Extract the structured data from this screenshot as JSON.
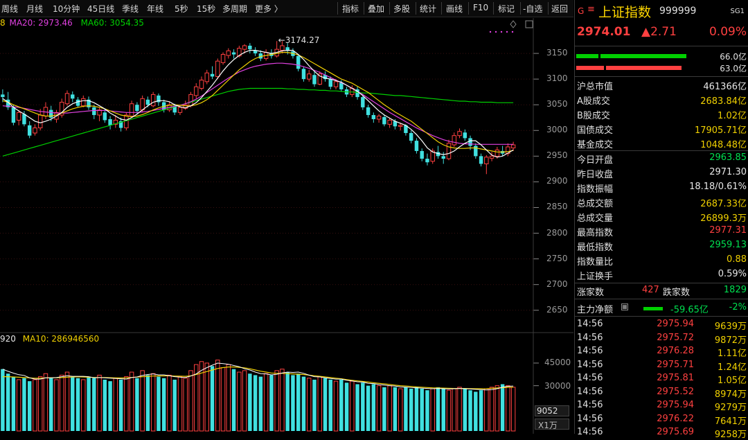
{
  "toolbar": {
    "periods": [
      "周线",
      "月线",
      "10分钟",
      "45日线",
      "季线",
      "年线",
      "5秒",
      "15秒",
      "多周期",
      "更多 〉"
    ],
    "tools": [
      "指标",
      "叠加",
      "多股",
      "统计",
      "画线",
      "F10",
      "标记",
      "-自选",
      "返回"
    ]
  },
  "chart": {
    "ma_legend": {
      "ma_prefix": "8",
      "ma20": "MA20: 2973.46",
      "ma60": "MA60: 3054.35"
    },
    "peak_label": "3174.27",
    "y_ticks": [
      "3150",
      "3100",
      "3050",
      "3000",
      "2950",
      "2900",
      "2850",
      "2800",
      "2750",
      "2700",
      "2650"
    ],
    "vol_legend": {
      "prefix": "920",
      "ma10": "MA10: 286946560"
    },
    "vol_ticks": [
      "45000",
      "30000"
    ],
    "vol_value": "9052",
    "vol_unit": "X1万",
    "colors": {
      "up": "#ff4040",
      "down": "#40e0e0",
      "ma5": "#ffffff",
      "ma10": "#f0d000",
      "ma20": "#e040e0",
      "ma60": "#00d000"
    }
  },
  "chart_data": {
    "type": "candlestick",
    "ylim": [
      2620,
      3200
    ],
    "candles": [
      [
        3070,
        3065,
        3080,
        3055
      ],
      [
        3060,
        3045,
        3075,
        3040
      ],
      [
        3045,
        3015,
        3050,
        3010
      ],
      [
        3020,
        3035,
        3040,
        3010
      ],
      [
        3032,
        3012,
        3038,
        3008
      ],
      [
        3010,
        2990,
        3018,
        2985
      ],
      [
        2995,
        3005,
        3012,
        2990
      ],
      [
        3005,
        3030,
        3042,
        3000
      ],
      [
        3028,
        3045,
        3055,
        3022
      ],
      [
        3040,
        3025,
        3048,
        3018
      ],
      [
        3022,
        3035,
        3040,
        3015
      ],
      [
        3030,
        3055,
        3062,
        3025
      ],
      [
        3052,
        3072,
        3078,
        3048
      ],
      [
        3070,
        3062,
        3076,
        3055
      ],
      [
        3060,
        3048,
        3065,
        3045
      ],
      [
        3048,
        3062,
        3068,
        3045
      ],
      [
        3060,
        3045,
        3066,
        3040
      ],
      [
        3045,
        3030,
        3050,
        3022
      ],
      [
        3030,
        3040,
        3045,
        3018
      ],
      [
        3035,
        3020,
        3042,
        3015
      ],
      [
        3022,
        3010,
        3028,
        3002
      ],
      [
        3012,
        3020,
        3030,
        3005
      ],
      [
        3018,
        3005,
        3025,
        2998
      ],
      [
        3005,
        3030,
        3035,
        3000
      ],
      [
        3028,
        3052,
        3058,
        3025
      ],
      [
        3050,
        3038,
        3055,
        3032
      ],
      [
        3040,
        3062,
        3068,
        3035
      ],
      [
        3060,
        3050,
        3066,
        3045
      ],
      [
        3048,
        3070,
        3075,
        3045
      ],
      [
        3068,
        3055,
        3072,
        3048
      ],
      [
        3055,
        3040,
        3060,
        3035
      ],
      [
        3040,
        3050,
        3056,
        3036
      ],
      [
        3048,
        3035,
        3052,
        3030
      ],
      [
        3035,
        3045,
        3050,
        3030
      ],
      [
        3043,
        3050,
        3058,
        3040
      ],
      [
        3048,
        3070,
        3075,
        3045
      ],
      [
        3068,
        3085,
        3092,
        3062
      ],
      [
        3082,
        3098,
        3105,
        3078
      ],
      [
        3095,
        3112,
        3118,
        3090
      ],
      [
        3110,
        3105,
        3125,
        3100
      ],
      [
        3105,
        3135,
        3140,
        3100
      ],
      [
        3132,
        3148,
        3152,
        3128
      ],
      [
        3146,
        3155,
        3160,
        3140
      ],
      [
        3152,
        3148,
        3158,
        3140
      ],
      [
        3145,
        3160,
        3165,
        3142
      ],
      [
        3158,
        3165,
        3168,
        3150
      ],
      [
        3165,
        3158,
        3170,
        3150
      ],
      [
        3156,
        3150,
        3162,
        3145
      ],
      [
        3150,
        3140,
        3156,
        3135
      ],
      [
        3140,
        3152,
        3158,
        3136
      ],
      [
        3150,
        3145,
        3158,
        3140
      ],
      [
        3145,
        3158,
        3174,
        3142
      ],
      [
        3156,
        3165,
        3174,
        3150
      ],
      [
        3162,
        3155,
        3170,
        3148
      ],
      [
        3154,
        3145,
        3160,
        3140
      ],
      [
        3145,
        3120,
        3148,
        3115
      ],
      [
        3120,
        3100,
        3125,
        3095
      ],
      [
        3100,
        3110,
        3118,
        3095
      ],
      [
        3108,
        3090,
        3115,
        3085
      ],
      [
        3090,
        3110,
        3115,
        3088
      ],
      [
        3108,
        3100,
        3115,
        3095
      ],
      [
        3100,
        3085,
        3105,
        3080
      ],
      [
        3085,
        3095,
        3100,
        3080
      ],
      [
        3093,
        3080,
        3098,
        3075
      ],
      [
        3080,
        3070,
        3085,
        3065
      ],
      [
        3070,
        3082,
        3088,
        3065
      ],
      [
        3080,
        3065,
        3085,
        3060
      ],
      [
        3065,
        3045,
        3068,
        3040
      ],
      [
        3045,
        3030,
        3050,
        3025
      ],
      [
        3030,
        3022,
        3035,
        3015
      ],
      [
        3022,
        3028,
        3032,
        3015
      ],
      [
        3026,
        3012,
        3030,
        3008
      ],
      [
        3012,
        3020,
        3025,
        3005
      ],
      [
        3018,
        3008,
        3022,
        3002
      ],
      [
        3008,
        3010,
        3015,
        3000
      ],
      [
        3010,
        2995,
        3012,
        2990
      ],
      [
        2995,
        2980,
        3000,
        2975
      ],
      [
        2980,
        2960,
        2985,
        2955
      ],
      [
        2960,
        2945,
        2965,
        2940
      ],
      [
        2945,
        2938,
        2955,
        2932
      ],
      [
        2940,
        2960,
        2965,
        2935
      ],
      [
        2958,
        2950,
        2970,
        2945
      ],
      [
        2950,
        2945,
        2958,
        2935
      ],
      [
        2945,
        2975,
        2982,
        2942
      ],
      [
        2972,
        2990,
        2996,
        2968
      ],
      [
        2990,
        2998,
        3004,
        2985
      ],
      [
        2996,
        2985,
        3002,
        2980
      ],
      [
        2985,
        2970,
        2990,
        2962
      ],
      [
        2970,
        2950,
        2975,
        2945
      ],
      [
        2950,
        2935,
        2955,
        2930
      ],
      [
        2935,
        2948,
        2952,
        2915
      ],
      [
        2946,
        2950,
        2958,
        2940
      ],
      [
        2950,
        2962,
        2968,
        2945
      ],
      [
        2960,
        2955,
        2970,
        2950
      ],
      [
        2955,
        2968,
        2975,
        2950
      ],
      [
        2966,
        2972,
        2978,
        2960
      ]
    ],
    "ma5": [
      3062,
      3055,
      3045,
      3038,
      3032,
      3025,
      3018,
      3015,
      3018,
      3022,
      3028,
      3035,
      3045,
      3052,
      3056,
      3058,
      3058,
      3054,
      3048,
      3042,
      3034,
      3028,
      3022,
      3020,
      3025,
      3032,
      3040,
      3048,
      3055,
      3058,
      3058,
      3056,
      3050,
      3046,
      3044,
      3048,
      3054,
      3064,
      3076,
      3088,
      3102,
      3116,
      3128,
      3138,
      3146,
      3152,
      3156,
      3156,
      3154,
      3152,
      3150,
      3152,
      3155,
      3156,
      3156,
      3148,
      3138,
      3126,
      3115,
      3106,
      3102,
      3100,
      3097,
      3094,
      3088,
      3082,
      3076,
      3068,
      3058,
      3048,
      3038,
      3030,
      3024,
      3018,
      3014,
      3010,
      3002,
      2992,
      2980,
      2966,
      2958,
      2955,
      2953,
      2955,
      2960,
      2968,
      2975,
      2980,
      2980,
      2972,
      2962,
      2952,
      2948,
      2950,
      2956,
      2962
    ],
    "ma10": [
      3058,
      3055,
      3050,
      3046,
      3042,
      3038,
      3034,
      3030,
      3028,
      3028,
      3030,
      3034,
      3038,
      3042,
      3045,
      3047,
      3048,
      3047,
      3045,
      3042,
      3038,
      3034,
      3030,
      3028,
      3027,
      3028,
      3031,
      3035,
      3040,
      3044,
      3047,
      3049,
      3050,
      3049,
      3048,
      3048,
      3050,
      3054,
      3060,
      3068,
      3078,
      3088,
      3098,
      3108,
      3118,
      3126,
      3134,
      3140,
      3144,
      3146,
      3148,
      3150,
      3152,
      3152,
      3150,
      3147,
      3142,
      3136,
      3130,
      3124,
      3118,
      3112,
      3106,
      3100,
      3096,
      3092,
      3086,
      3080,
      3074,
      3066,
      3058,
      3050,
      3043,
      3036,
      3030,
      3024,
      3018,
      3010,
      3002,
      2994,
      2986,
      2978,
      2972,
      2968,
      2966,
      2965,
      2965,
      2966,
      2966,
      2964,
      2962,
      2960,
      2958,
      2958,
      2959,
      2961
    ],
    "ma20": [
      3048,
      3047,
      3046,
      3045,
      3043,
      3041,
      3039,
      3037,
      3036,
      3035,
      3034,
      3034,
      3034,
      3035,
      3036,
      3037,
      3038,
      3039,
      3039,
      3039,
      3038,
      3037,
      3036,
      3035,
      3035,
      3035,
      3036,
      3037,
      3039,
      3041,
      3043,
      3045,
      3047,
      3049,
      3052,
      3056,
      3061,
      3067,
      3074,
      3081,
      3088,
      3095,
      3102,
      3108,
      3114,
      3118,
      3122,
      3125,
      3127,
      3129,
      3130,
      3131,
      3131,
      3130,
      3129,
      3127,
      3124,
      3121,
      3117,
      3113,
      3108,
      3103,
      3098,
      3093,
      3088,
      3082,
      3076,
      3070,
      3063,
      3056,
      3049,
      3042,
      3035,
      3029,
      3023,
      3017,
      3011,
      3005,
      3000,
      2995,
      2990,
      2986,
      2982,
      2979,
      2977,
      2975,
      2974,
      2974,
      2973,
      2973,
      2973,
      2973,
      2973,
      2973,
      2973,
      2973
    ],
    "ma60": [
      2950,
      2953,
      2956,
      2959,
      2962,
      2965,
      2968,
      2971,
      2974,
      2977,
      2980,
      2983,
      2986,
      2989,
      2992,
      2995,
      2998,
      3001,
      3004,
      3007,
      3010,
      3013,
      3016,
      3019,
      3022,
      3025,
      3028,
      3031,
      3034,
      3037,
      3040,
      3043,
      3046,
      3049,
      3052,
      3055,
      3058,
      3061,
      3064,
      3067,
      3070,
      3073,
      3076,
      3078,
      3080,
      3081,
      3082,
      3082,
      3082,
      3082,
      3082,
      3082,
      3082,
      3081,
      3081,
      3080,
      3080,
      3079,
      3079,
      3078,
      3078,
      3077,
      3077,
      3076,
      3075,
      3075,
      3074,
      3073,
      3073,
      3072,
      3071,
      3070,
      3069,
      3068,
      3068,
      3067,
      3066,
      3065,
      3064,
      3063,
      3062,
      3061,
      3060,
      3059,
      3058,
      3057,
      3057,
      3056,
      3056,
      3055,
      3055,
      3055,
      3054,
      3054,
      3054,
      3054
    ],
    "volume": [
      41000,
      38000,
      36000,
      34000,
      35000,
      33000,
      34000,
      36000,
      38000,
      35000,
      34000,
      37000,
      39000,
      36000,
      35000,
      34000,
      36000,
      35000,
      37000,
      34000,
      33000,
      35000,
      34000,
      36000,
      39000,
      35000,
      40000,
      37000,
      38000,
      36000,
      35000,
      37000,
      34000,
      36000,
      35000,
      40000,
      44000,
      46000,
      45000,
      43000,
      47000,
      42000,
      44000,
      41000,
      39000,
      40000,
      38000,
      37000,
      36000,
      38000,
      37000,
      40000,
      41000,
      39000,
      37000,
      38000,
      36000,
      35000,
      34000,
      36000,
      35000,
      34000,
      33000,
      34000,
      32000,
      33000,
      31000,
      32000,
      30000,
      31000,
      30000,
      29000,
      30000,
      29000,
      28000,
      29000,
      28000,
      29000,
      28000,
      27000,
      28000,
      29000,
      28000,
      27000,
      28000,
      29000,
      28000,
      27000,
      26000,
      27000,
      28000,
      29000,
      30000,
      31000,
      30000,
      29000
    ],
    "vol_ma": [
      36000,
      36000,
      35800,
      35600,
      35400,
      35200,
      35000,
      35000,
      35200,
      35300,
      35300,
      35400,
      35600,
      35800,
      35900,
      35800,
      35600,
      35500,
      35400,
      35400,
      35300,
      35200,
      35100,
      35200,
      35500,
      35700,
      36000,
      36200,
      36400,
      36500,
      36500,
      36600,
      36400,
      36300,
      36200,
      36600,
      37400,
      38400,
      39400,
      40400,
      41400,
      42000,
      42400,
      42400,
      42200,
      41800,
      41200,
      40400,
      39600,
      39000,
      38400,
      38200,
      38200,
      38000,
      37800,
      37600,
      37400,
      37000,
      36600,
      36200,
      35800,
      35400,
      35000,
      34600,
      34000,
      33600,
      33200,
      32800,
      32400,
      32000,
      31600,
      31200,
      30800,
      30400,
      30000,
      29800,
      29500,
      29200,
      29000,
      28800,
      28600,
      28500,
      28400,
      28300,
      28200,
      28200,
      28200,
      28100,
      28000,
      28000,
      28100,
      28300,
      28500,
      28700,
      28900,
      29000
    ]
  },
  "quote": {
    "flag": "G",
    "name": "上证指数",
    "code": "999999",
    "tag": "SG1",
    "last": "2974.01",
    "change": "▲2.71",
    "pct": "0.09%",
    "bar1_value": "66.0亿",
    "bar2_value": "63.0亿"
  },
  "stats": [
    {
      "k": "沪总市值",
      "v": "461366亿",
      "c": "white"
    },
    {
      "k": "A股成交",
      "v": "2683.84亿",
      "c": "yellow"
    },
    {
      "k": "B股成交",
      "v": "1.02亿",
      "c": "yellow"
    },
    {
      "k": "国债成交",
      "v": "17905.71亿",
      "c": "yellow"
    },
    {
      "k": "基金成交",
      "v": "1048.48亿",
      "c": "yellow"
    },
    {
      "k": "今日开盘",
      "v": "2963.85",
      "c": "green"
    },
    {
      "k": "昨日收盘",
      "v": "2971.30",
      "c": "white"
    },
    {
      "k": "指数振幅",
      "v": "18.18/0.61%",
      "c": "white"
    },
    {
      "k": "总成交额",
      "v": "2687.33亿",
      "c": "yellow"
    },
    {
      "k": "总成交量",
      "v": "26899.3万",
      "c": "yellow"
    },
    {
      "k": "最高指数",
      "v": "2977.31",
      "c": "red"
    },
    {
      "k": "最低指数",
      "v": "2959.13",
      "c": "green"
    },
    {
      "k": "指数量比",
      "v": "0.88",
      "c": "yellow"
    },
    {
      "k": "上证换手",
      "v": "0.59%",
      "c": "white"
    }
  ],
  "breadth": {
    "up_label": "涨家数",
    "up": "427",
    "down_label": "跌家数",
    "down": "1829"
  },
  "netflow": {
    "label": "主力净额",
    "value": "-59.65亿",
    "pct": "-2%"
  },
  "ticks": [
    {
      "t": "14:56",
      "p": "2975.94",
      "q": "9639万"
    },
    {
      "t": "14:56",
      "p": "2975.72",
      "q": "9872万"
    },
    {
      "t": "14:56",
      "p": "2976.28",
      "q": "1.11亿"
    },
    {
      "t": "14:56",
      "p": "2975.71",
      "q": "1.24亿"
    },
    {
      "t": "14:56",
      "p": "2975.81",
      "q": "1.05亿"
    },
    {
      "t": "14:56",
      "p": "2975.52",
      "q": "8974万"
    },
    {
      "t": "14:56",
      "p": "2975.94",
      "q": "9279万"
    },
    {
      "t": "14:56",
      "p": "2976.22",
      "q": "7641万"
    },
    {
      "t": "14:56",
      "p": "2975.69",
      "q": "9258万"
    }
  ]
}
